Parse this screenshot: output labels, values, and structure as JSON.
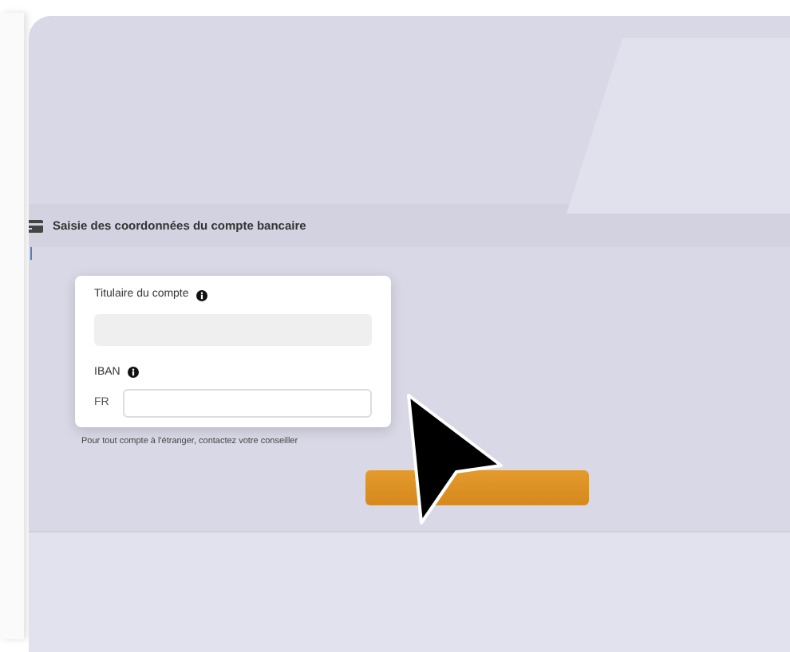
{
  "section": {
    "title": "Saisie des coordonnées du compte bancaire"
  },
  "form": {
    "holder": {
      "label": "Titulaire du compte"
    },
    "iban": {
      "label": "IBAN",
      "prefix": "FR"
    },
    "note": "Pour tout compte à l'étranger, contactez votre conseiller"
  },
  "pointer": {
    "visible": true
  }
}
